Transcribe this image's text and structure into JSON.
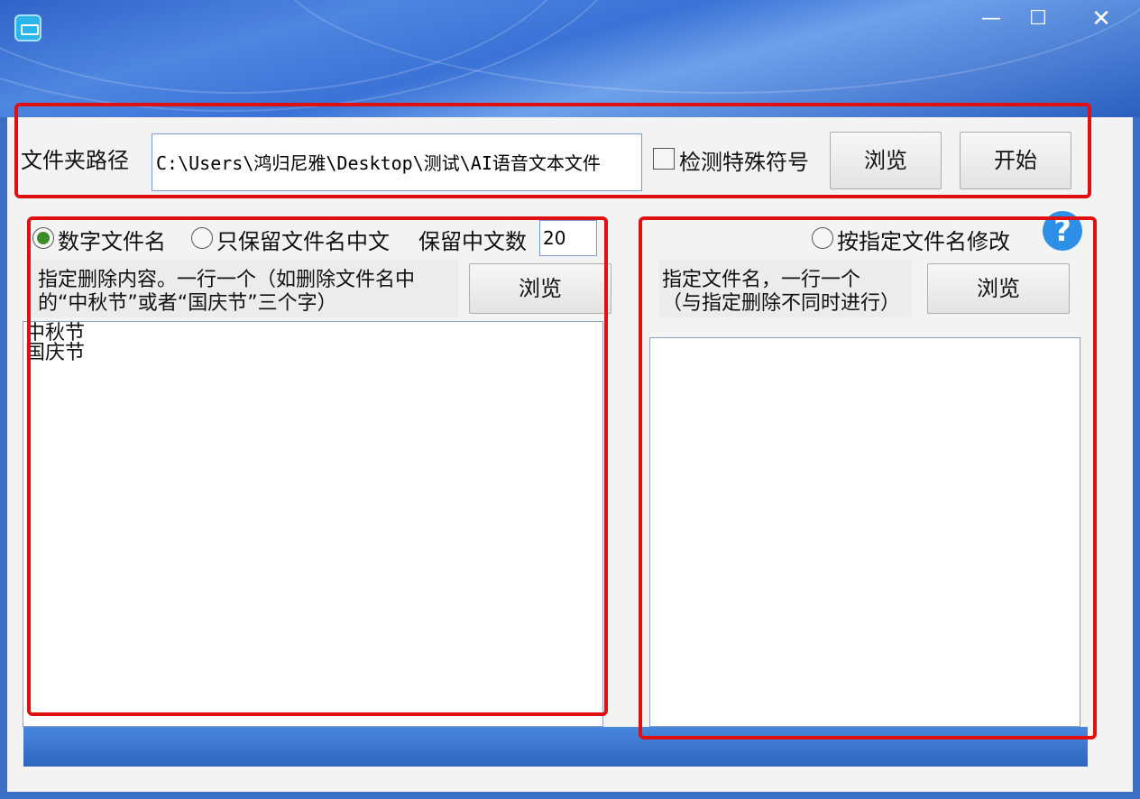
{
  "window": {
    "title_icon": "app-icon",
    "minimize_glyph": "—",
    "maximize_glyph": "☐",
    "close_glyph": "✕"
  },
  "top": {
    "folder_label": "文件夹路径",
    "folder_path": "C:\\Users\\鸿归尼雅\\Desktop\\测试\\AI语音文本文件",
    "check_special_label": "检测特殊符号",
    "check_special_checked": false,
    "browse_label": "浏览",
    "start_label": "开始"
  },
  "left": {
    "radio_numeric_label": "数字文件名",
    "radio_numeric_selected": true,
    "radio_chinese_label": "只保留文件名中文",
    "radio_chinese_selected": false,
    "keep_count_label": "保留中文数",
    "keep_count_value": "20",
    "desc_line1": "指定删除内容。一行一个（如删除文件名中",
    "desc_line2": "的“中秋节”或者“国庆节”三个字）",
    "browse_label": "浏览",
    "memo_text": "中秋节\n国庆节"
  },
  "right": {
    "radio_rename_label": "按指定文件名修改",
    "radio_rename_selected": false,
    "desc_line1": "指定文件名，一行一个",
    "desc_line2": "（与指定删除不同时进行）",
    "browse_label": "浏览",
    "memo_text": "",
    "help_glyph": "?"
  },
  "colors": {
    "annotation_red": "#e01010",
    "radio_selected_green": "#3c8c2a",
    "help_blue": "#2e8fe6"
  }
}
